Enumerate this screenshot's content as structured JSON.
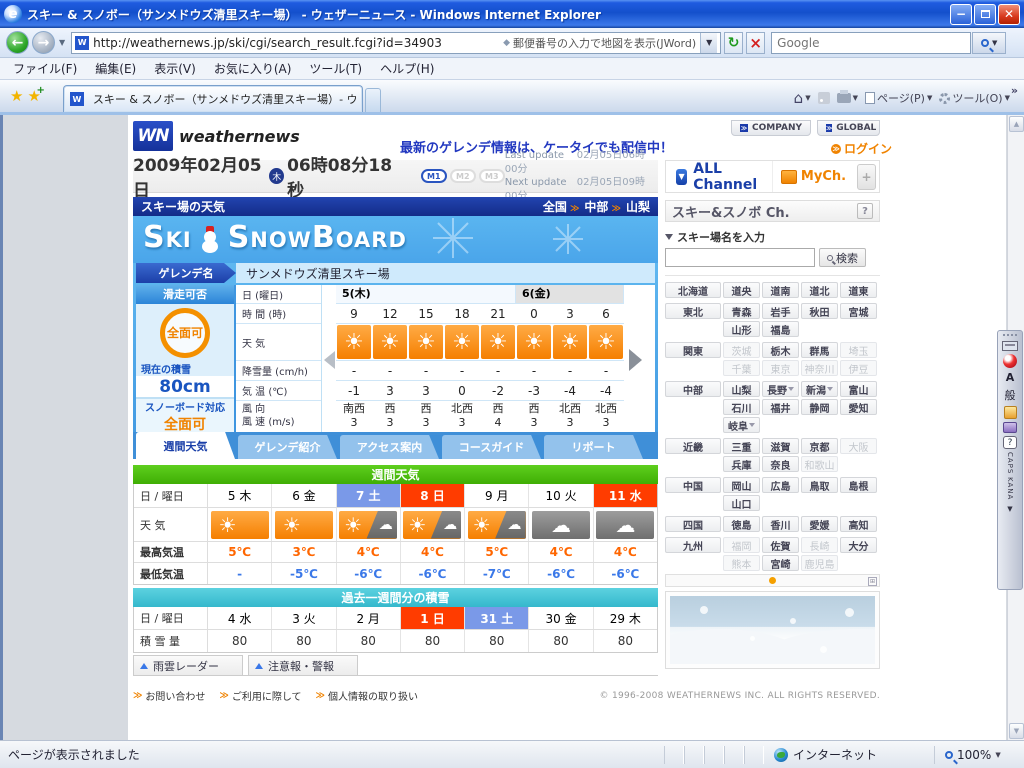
{
  "browser": {
    "title": "スキー & スノボー（サンメドウズ清里スキー場） - ウェザーニュース - Windows Internet Explorer",
    "url": "http://weathernews.jp/ski/cgi/search_result.fcgi?id=34903",
    "address_hint": "郵便番号の入力で地図を表示(JWord)",
    "search_placeholder": "Google",
    "menus": [
      "ファイル(F)",
      "編集(E)",
      "表示(V)",
      "お気に入り(A)",
      "ツール(T)",
      "ヘルプ(H)"
    ],
    "tab_title": "スキー & スノボー（サンメドウズ清里スキー場）- ウェザー...",
    "toolbar_page": "ページ(P)",
    "toolbar_tools": "ツール(O)",
    "overflow_chevron": "»",
    "status_text": "ページが表示されました",
    "status_zone": "インターネット",
    "status_zoom": "100%"
  },
  "header": {
    "logo_mark": "WN",
    "logo_text": "weathernews",
    "company": "COMPANY",
    "global": "GLOBAL",
    "promo": "最新のゲレンデ情報は、ケータイでも配信中！",
    "login": "ログイン",
    "date_text": "2009年02月05日",
    "weekday": "木",
    "time_text": "06時08分18秒",
    "m_buttons": [
      "M1",
      "M2",
      "M3"
    ],
    "last_update_label": "Last update",
    "last_update": "02月05日06時00分",
    "next_update_label": "Next update",
    "next_update": "02月05日09時00分",
    "all_channel": "ALL Channel",
    "mych": "MyCh."
  },
  "page": {
    "section_title": "スキー場の天気",
    "breadcrumb": [
      "全国",
      "中部",
      "山梨"
    ],
    "banner_word1": "Ski",
    "banner_word2": "SnowBoard",
    "resort_label": "ゲレンデ名",
    "resort_name": "サンメドウズ清里スキー場"
  },
  "conditions": {
    "title": "滑走可否",
    "badge": "全面可",
    "snow_label": "現在の積雪",
    "snow_value": "80cm",
    "board_label": "スノーボード対応",
    "board_value": "全面可"
  },
  "forecast": {
    "row_labels": {
      "day": "日 (曜日)",
      "hour": "時 間 (時)",
      "weather": "天 気",
      "snowfall": "降雪量 (cm/h)",
      "temp": "気 温 (℃)",
      "wind": "風 向",
      "wind2": "風 速 (m/s)"
    },
    "day_groups": [
      {
        "label": "5(木)",
        "span": 5,
        "gray": false
      },
      {
        "label": "6(金)",
        "span": 3,
        "gray": true
      }
    ],
    "hours": [
      "9",
      "12",
      "15",
      "18",
      "21",
      "0",
      "3",
      "6"
    ],
    "weather": [
      "sunny",
      "sunny",
      "sunny",
      "sunny",
      "sunny",
      "sunny",
      "sunny",
      "sunny"
    ],
    "snowfall": [
      "-",
      "-",
      "-",
      "-",
      "-",
      "-",
      "-",
      "-"
    ],
    "temps": [
      "-1",
      "3",
      "3",
      "0",
      "-2",
      "-3",
      "-4",
      "-4"
    ],
    "winds": [
      {
        "dir": "南西",
        "speed": "3"
      },
      {
        "dir": "西",
        "speed": "3"
      },
      {
        "dir": "西",
        "speed": "3"
      },
      {
        "dir": "北西",
        "speed": "3"
      },
      {
        "dir": "西",
        "speed": "4"
      },
      {
        "dir": "西",
        "speed": "3"
      },
      {
        "dir": "北西",
        "speed": "3"
      },
      {
        "dir": "北西",
        "speed": "3"
      }
    ]
  },
  "tabs": [
    {
      "label": "週間天気",
      "active": true
    },
    {
      "label": "ゲレンデ紹介",
      "active": false
    },
    {
      "label": "アクセス案内",
      "active": false
    },
    {
      "label": "コースガイド",
      "active": false
    },
    {
      "label": "リポート",
      "active": false
    }
  ],
  "weekly": {
    "title": "週間天気",
    "row_labels": [
      "日 / 曜日",
      "天 気",
      "最高気温",
      "最低気温"
    ],
    "columns": [
      {
        "day": "5 木",
        "type": "normal",
        "icon": "sunny",
        "high": "5℃",
        "low": "-"
      },
      {
        "day": "6 金",
        "type": "normal",
        "icon": "sunny",
        "high": "3℃",
        "low": "-5℃"
      },
      {
        "day": "7 土",
        "type": "sat",
        "icon": "sun_cloud",
        "high": "4℃",
        "low": "-6℃"
      },
      {
        "day": "8 日",
        "type": "sun",
        "icon": "sun_cloud",
        "high": "4℃",
        "low": "-6℃"
      },
      {
        "day": "9 月",
        "type": "normal",
        "icon": "sun_cloud",
        "high": "5℃",
        "low": "-7℃"
      },
      {
        "day": "10 火",
        "type": "normal",
        "icon": "cloudy",
        "high": "4℃",
        "low": "-6℃"
      },
      {
        "day": "11 水",
        "type": "sun",
        "icon": "cloudy",
        "high": "4℃",
        "low": "-6℃"
      }
    ]
  },
  "past_snow": {
    "title": "過去一週間分の積雪",
    "row_labels": [
      "日 / 曜日",
      "積 雪 量"
    ],
    "columns": [
      {
        "day": "4 水",
        "type": "normal",
        "value": "80"
      },
      {
        "day": "3 火",
        "type": "normal",
        "value": "80"
      },
      {
        "day": "2 月",
        "type": "normal",
        "value": "80"
      },
      {
        "day": "1 日",
        "type": "sun",
        "value": "80"
      },
      {
        "day": "31 土",
        "type": "sat",
        "value": "80"
      },
      {
        "day": "30 金",
        "type": "normal",
        "value": "80"
      },
      {
        "day": "29 木",
        "type": "normal",
        "value": "80"
      }
    ]
  },
  "extra_buttons": [
    "雨雲レーダー",
    "注意報・警報"
  ],
  "footer": {
    "links": [
      "お問い合わせ",
      "ご利用に際して",
      "個人情報の取り扱い"
    ],
    "copyright": "© 1996-2008 WEATHERNEWS INC. ALL RIGHTS RESERVED."
  },
  "sidebar": {
    "title": "スキー&スノボ Ch.",
    "help": "?",
    "search_label": "スキー場名を入力",
    "search_button": "検索",
    "region_rows": [
      {
        "region": "北海道",
        "prefs": [
          {
            "label": "道央"
          },
          {
            "label": "道南"
          },
          {
            "label": "道北"
          },
          {
            "label": "道東"
          }
        ]
      },
      {
        "region": "東北",
        "prefs": [
          {
            "label": "青森"
          },
          {
            "label": "岩手"
          },
          {
            "label": "秋田"
          },
          {
            "label": "宮城"
          }
        ]
      },
      {
        "region": "",
        "prefs": [
          {
            "label": "山形"
          },
          {
            "label": "福島"
          },
          null,
          null
        ]
      },
      {
        "region": "関東",
        "prefs": [
          {
            "label": "茨城",
            "disabled": true
          },
          {
            "label": "栃木"
          },
          {
            "label": "群馬"
          },
          {
            "label": "埼玉",
            "disabled": true
          }
        ]
      },
      {
        "region": "",
        "prefs": [
          {
            "label": "千葉",
            "disabled": true
          },
          {
            "label": "東京",
            "disabled": true
          },
          {
            "label": "神奈川",
            "disabled": true
          },
          {
            "label": "伊豆",
            "disabled": true
          }
        ]
      },
      {
        "region": "中部",
        "prefs": [
          {
            "label": "山梨"
          },
          {
            "label": "長野",
            "arrow": true
          },
          {
            "label": "新潟",
            "arrow": true
          },
          {
            "label": "富山"
          }
        ]
      },
      {
        "region": "",
        "prefs": [
          {
            "label": "石川"
          },
          {
            "label": "福井"
          },
          {
            "label": "静岡"
          },
          {
            "label": "愛知"
          }
        ]
      },
      {
        "region": "",
        "prefs": [
          {
            "label": "岐阜",
            "arrow": true
          },
          null,
          null,
          null
        ]
      },
      {
        "region": "近畿",
        "prefs": [
          {
            "label": "三重"
          },
          {
            "label": "滋賀"
          },
          {
            "label": "京都"
          },
          {
            "label": "大阪",
            "disabled": true
          }
        ]
      },
      {
        "region": "",
        "prefs": [
          {
            "label": "兵庫"
          },
          {
            "label": "奈良"
          },
          {
            "label": "和歌山",
            "disabled": true
          },
          null
        ]
      },
      {
        "region": "中国",
        "prefs": [
          {
            "label": "岡山"
          },
          {
            "label": "広島"
          },
          {
            "label": "鳥取"
          },
          {
            "label": "島根"
          }
        ]
      },
      {
        "region": "",
        "prefs": [
          {
            "label": "山口"
          },
          null,
          null,
          null
        ]
      },
      {
        "region": "四国",
        "prefs": [
          {
            "label": "徳島"
          },
          {
            "label": "香川"
          },
          {
            "label": "愛媛"
          },
          {
            "label": "高知"
          }
        ]
      },
      {
        "region": "九州",
        "prefs": [
          {
            "label": "福岡",
            "disabled": true
          },
          {
            "label": "佐賀"
          },
          {
            "label": "長崎",
            "disabled": true
          },
          {
            "label": "大分"
          }
        ]
      },
      {
        "region": "",
        "prefs": [
          {
            "label": "熊本",
            "disabled": true
          },
          {
            "label": "宮崎"
          },
          {
            "label": "鹿児島",
            "disabled": true
          },
          null
        ]
      }
    ]
  },
  "ime": {
    "mode_general": "般",
    "mode_a": "A",
    "caps": "CAPS",
    "kana": "KANA",
    "help": "?"
  }
}
